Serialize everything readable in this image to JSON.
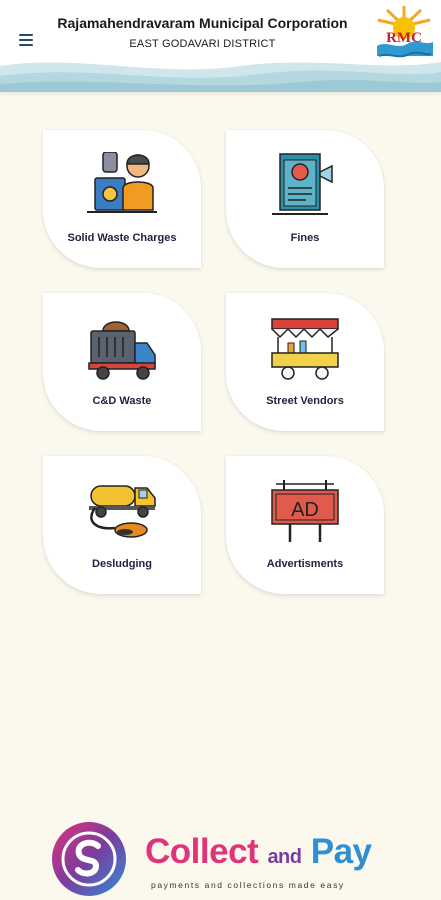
{
  "header": {
    "title": "Rajamahendravaram Municipal Corporation",
    "subtitle": "EAST GODAVARI DISTRICT",
    "logo_text": "RMC"
  },
  "menu": {
    "icon": "hamburger-menu-icon"
  },
  "services": [
    {
      "label": "Solid Waste Charges",
      "icon": "waste-collector-icon"
    },
    {
      "label": "Fines",
      "icon": "fine-notice-icon"
    },
    {
      "label": "C&D Waste",
      "icon": "dump-truck-icon"
    },
    {
      "label": "Street Vendors",
      "icon": "vendor-cart-icon"
    },
    {
      "label": "Desludging",
      "icon": "septic-tanker-icon"
    },
    {
      "label": "Advertisments",
      "icon": "billboard-icon"
    }
  ],
  "billboard_text": "AD",
  "footer": {
    "brand_word1": "Collect",
    "brand_word2": "and",
    "brand_word3": "Pay",
    "tagline": "payments and collections made easy"
  },
  "colors": {
    "background": "#fbf9ee",
    "card": "#ffffff",
    "brand_pink": "#e0337a",
    "brand_purple": "#7a3d9e",
    "brand_blue": "#2f8fd6"
  }
}
